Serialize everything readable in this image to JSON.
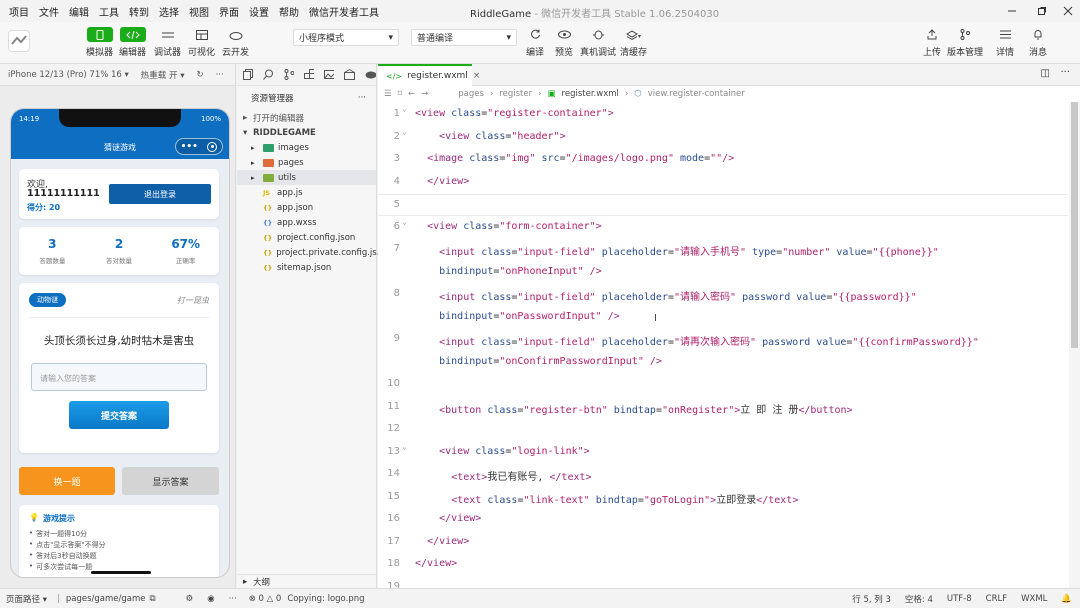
{
  "menubar": {
    "items": [
      "项目",
      "文件",
      "编辑",
      "工具",
      "转到",
      "选择",
      "视图",
      "界面",
      "设置",
      "帮助",
      "微信开发者工具"
    ],
    "app_title": "RiddleGame",
    "app_subtitle": "- 微信开发者工具 Stable 1.06.2504030"
  },
  "toolbar": {
    "simulator_label": "模拟器",
    "editor_label": "编辑器",
    "debugger_label": "调试器",
    "visual_label": "可视化",
    "cloud_label": "云开发",
    "mode_select": "小程序模式",
    "compile_select": "普通编译",
    "compile_label": "编译",
    "preview_label": "预览",
    "realdebug_label": "真机调试",
    "clearcache_label": "清缓存",
    "upload_label": "上传",
    "version_label": "版本管理",
    "details_label": "详情",
    "messages_label": "消息"
  },
  "simulator": {
    "device_label": "iPhone 12/13 (Pro) 71% 16 ▾",
    "hotreload_label": "热重载 开 ▾",
    "phone": {
      "time": "14:19",
      "battery": "100%",
      "nav_title": "猜谜游戏",
      "welcome": "欢迎,",
      "username": "11111111111",
      "score_text": "得分: 20",
      "logout_btn": "退出登录",
      "stats": [
        {
          "value": "3",
          "label": "答题数量"
        },
        {
          "value": "2",
          "label": "答对数量"
        },
        {
          "value": "67%",
          "label": "正确率"
        }
      ],
      "riddle_tag": "动物谜",
      "riddle_category": "打一昆虫",
      "riddle_question": "头顶长须长过身,幼时牯木是害虫",
      "answer_placeholder": "请输入您的答案",
      "submit_btn": "提交答案",
      "next_btn": "换一题",
      "show_btn": "显示答案",
      "tips_title": "游戏提示",
      "tips": [
        "答对一题得10分",
        "点击\"显示答案\"不得分",
        "答对后3秒自动换题",
        "可多次尝试每一题"
      ]
    }
  },
  "explorer": {
    "title": "资源管理器",
    "open_editors": "打开的编辑器",
    "project": "RIDDLEGAME",
    "folders": [
      "images",
      "pages",
      "utils"
    ],
    "files": [
      "app.js",
      "app.json",
      "app.wxss",
      "project.config.json",
      "project.private.config.js...",
      "sitemap.json"
    ],
    "outline": "大纲"
  },
  "editor": {
    "tab": "register.wxml",
    "breadcrumb": [
      "pages",
      "register",
      "register.wxml",
      "view.register-container"
    ],
    "lines": [
      {
        "n": "1",
        "code": "<view class=\"register-container\">"
      },
      {
        "n": "2",
        "code": "    <view class=\"header\">"
      },
      {
        "n": "3",
        "code": "  <image class=\"img\" src=\"/images/logo.png\" mode=\"\"/>"
      },
      {
        "n": "4",
        "code": "  </view>"
      },
      {
        "n": "5",
        "code": ""
      },
      {
        "n": "6",
        "code": "  <view class=\"form-container\">"
      },
      {
        "n": "7",
        "code": "    <input class=\"input-field\" placeholder=\"请输入手机号\" type=\"number\" value=\"{{phone}}\""
      },
      {
        "n": "",
        "code": "    bindinput=\"onPhoneInput\" />"
      },
      {
        "n": "8",
        "code": "    <input class=\"input-field\" placeholder=\"请输入密码\" password value=\"{{password}}\""
      },
      {
        "n": "",
        "code": "    bindinput=\"onPasswordInput\" />"
      },
      {
        "n": "9",
        "code": "    <input class=\"input-field\" placeholder=\"请再次输入密码\" password value=\"{{confirmPassword}}\""
      },
      {
        "n": "",
        "code": "    bindinput=\"onConfirmPasswordInput\" />"
      },
      {
        "n": "10",
        "code": ""
      },
      {
        "n": "11",
        "code": "    <button class=\"register-btn\" bindtap=\"onRegister\">立 即 注 册</button>"
      },
      {
        "n": "12",
        "code": ""
      },
      {
        "n": "13",
        "code": "    <view class=\"login-link\">"
      },
      {
        "n": "14",
        "code": "      <text>我已有账号, </text>"
      },
      {
        "n": "15",
        "code": "      <text class=\"link-text\" bindtap=\"goToLogin\">立即登录</text>"
      },
      {
        "n": "16",
        "code": "    </view>"
      },
      {
        "n": "17",
        "code": "  </view>"
      },
      {
        "n": "18",
        "code": "</view>"
      },
      {
        "n": "19",
        "code": ""
      }
    ]
  },
  "statusbar": {
    "page_path_label": "页面路径 ▾",
    "page_path": "pages/game/game",
    "errors": "⊗ 0 △ 0",
    "message": "Copying: logo.png",
    "cursor": "行 5, 列 3",
    "indent": "空格: 4",
    "encoding": "UTF-8",
    "eol": "CRLF",
    "language": "WXML"
  },
  "colors": {
    "accent_green": "#1aad19",
    "phone_blue": "#0e6fc2",
    "orange": "#f7941d"
  }
}
